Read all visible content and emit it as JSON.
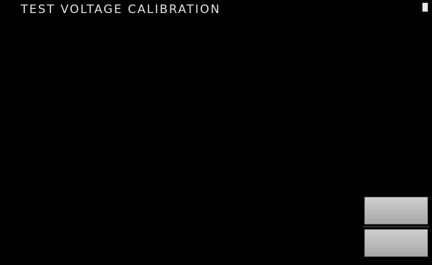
{
  "header": {
    "title": "TEST VOLTAGE CALIBRATION",
    "status_left": "",
    "status_right": ""
  },
  "instructions": [
    "",
    "",
    ""
  ],
  "stage": {
    "label": ""
  },
  "buttons": {
    "next_label": "",
    "back_label": ""
  },
  "colors": {
    "background": "#000000",
    "text": "#d8d8d8",
    "button": "#bdbdbd"
  },
  "icons": {
    "battery": "battery-icon"
  }
}
